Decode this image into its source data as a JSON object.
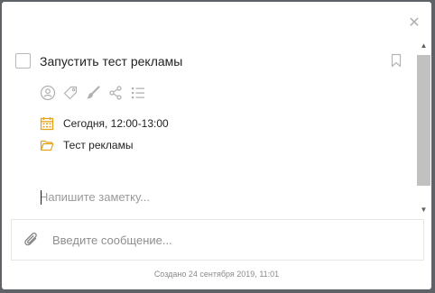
{
  "dialog": {
    "close_glyph": "✕"
  },
  "task": {
    "title": "Запустить тест рекламы",
    "checked": false,
    "action_icons": [
      "user-icon",
      "tag-icon",
      "brush-icon",
      "share-icon",
      "checklist-icon"
    ]
  },
  "details": {
    "date_text": "Сегодня, 12:00-13:00",
    "project_text": "Тест рекламы",
    "accent_color": "#e3a41b"
  },
  "note": {
    "placeholder": "Напишите заметку..."
  },
  "scrollbar": {
    "up_glyph": "▲",
    "down_glyph": "▼"
  },
  "message": {
    "placeholder": "Введите сообщение..."
  },
  "footer": {
    "created_text": "Создано 24 сентября 2019, 11:01"
  }
}
